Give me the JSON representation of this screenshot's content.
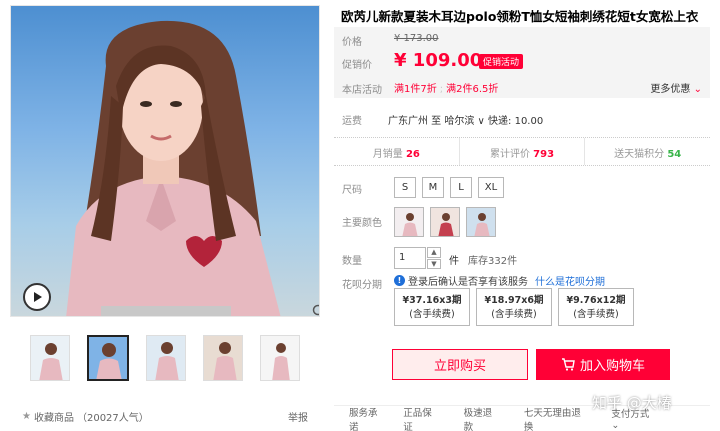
{
  "product": {
    "title": "欧芮儿新款夏装木耳边polo领粉T恤女短袖刺绣花短t女宽松上衣"
  },
  "price": {
    "label": "价格",
    "original": "¥ 173.00",
    "promo_label": "促销价",
    "current": "¥ 109.00",
    "promo_tag": "促销活动",
    "activity_label": "本店活动",
    "activity_1": "满1件7折",
    "activity_2": "满2件6.5折",
    "more_deals": "更多优惠"
  },
  "shipping": {
    "label": "运费",
    "info": "广东广州 至 哈尔滨 ∨ 快递: 10.00"
  },
  "stats": [
    {
      "label": "月销量",
      "value": "26"
    },
    {
      "label": "累计评价",
      "value": "793"
    },
    {
      "label": "送天猫积分",
      "value": "54"
    }
  ],
  "options": {
    "size_label": "尺码",
    "sizes": [
      "S",
      "M",
      "L",
      "XL"
    ],
    "color_label": "主要颜色",
    "quantity_label": "数量",
    "quantity_value": "1",
    "quantity_unit": "件",
    "stock": "库存332件"
  },
  "installment": {
    "label": "花呗分期",
    "tip": "登录后确认是否享有该服务",
    "tip_link": "什么是花呗分期",
    "plans": [
      {
        "price": "¥37.16x3期",
        "fee": "(含手续费)"
      },
      {
        "price": "¥18.97x6期",
        "fee": "(含手续费)"
      },
      {
        "price": "¥9.76x12期",
        "fee": "(含手续费)"
      }
    ]
  },
  "actions": {
    "buy_now": "立即购买",
    "add_cart": "加入购物车"
  },
  "gallery": {
    "favorite": "收藏商品",
    "popularity": "（20027人气）",
    "report": "举报"
  },
  "footer": {
    "label": "服务承诺",
    "items": [
      "正品保证",
      "极速退款",
      "七天无理由退换"
    ],
    "payment": "支付方式"
  },
  "watermark": "知乎 @大椿",
  "colors": {
    "accent": "#ff0036",
    "green": "#39b54a",
    "link": "#1f6fd8"
  }
}
